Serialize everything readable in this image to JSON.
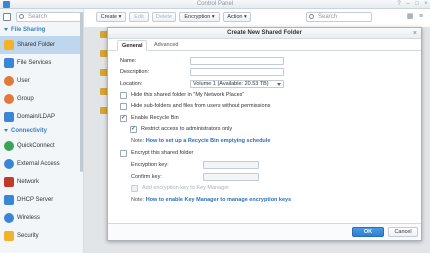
{
  "window": {
    "title": "Control Panel"
  },
  "sidebar": {
    "search_placeholder": "Search",
    "sections": [
      {
        "label": "File Sharing"
      },
      {
        "label": "Connectivity"
      }
    ],
    "items": [
      {
        "label": "Shared Folder",
        "icon": "shared-folder-icon",
        "color": "#f2b32a"
      },
      {
        "label": "File Services",
        "icon": "file-services-icon",
        "color": "#3a86d4"
      },
      {
        "label": "User",
        "icon": "user-icon",
        "color": "#e07a3a"
      },
      {
        "label": "Group",
        "icon": "group-icon",
        "color": "#e07a3a"
      },
      {
        "label": "Domain/LDAP",
        "icon": "domain-icon",
        "color": "#3a86d4"
      },
      {
        "label": "QuickConnect",
        "icon": "quickconnect-icon",
        "color": "#3aa556"
      },
      {
        "label": "External Access",
        "icon": "external-access-icon",
        "color": "#3a86d4"
      },
      {
        "label": "Network",
        "icon": "network-icon",
        "color": "#c0392b"
      },
      {
        "label": "DHCP Server",
        "icon": "dhcp-icon",
        "color": "#3a86d4"
      },
      {
        "label": "Wireless",
        "icon": "wireless-icon",
        "color": "#3a86d4"
      },
      {
        "label": "Security",
        "icon": "security-icon",
        "color": "#f2b32a"
      }
    ]
  },
  "toolbar": {
    "create": "Create ▾",
    "edit": "Edit",
    "delete": "Delete",
    "encryption": "Encryption ▾",
    "action": "Action ▾",
    "search_placeholder": "Search"
  },
  "dialog": {
    "title": "Create New Shared Folder",
    "tabs": [
      "General",
      "Advanced"
    ],
    "name_label": "Name:",
    "name_value": "",
    "description_label": "Description:",
    "description_value": "",
    "location_label": "Location:",
    "location_value": "Volume 1 (Available: 20.53 TB)",
    "hide_network_places": "Hide this shared folder in \"My Network Places\"",
    "hide_subfolders": "Hide sub-folders and files from users without permissions",
    "enable_recycle_bin": "Enable Recycle Bin",
    "restrict_admin": "Restrict access to administrators only",
    "note_label": "Note:",
    "recycle_note_link": "How to set up a Recycle Bin emptying schedule",
    "encrypt_label": "Encrypt this shared folder",
    "encryption_key_label": "Encryption key:",
    "confirm_key_label": "Confirm key:",
    "add_key_manager": "Add encryption key to Key Manager",
    "key_note_link": "How to enable Key Manager to manage encryption keys",
    "ok": "OK",
    "cancel": "Cancel"
  }
}
